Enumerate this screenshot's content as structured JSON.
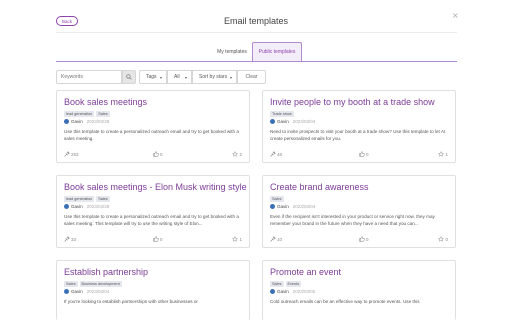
{
  "header": {
    "back_label": "Back",
    "title": "Email templates",
    "close_glyph": "×"
  },
  "tabs": [
    {
      "label": "My templates",
      "active": false
    },
    {
      "label": "Public templates",
      "active": true
    }
  ],
  "filters": {
    "search_placeholder": "Keywords",
    "tags_label": "Tags",
    "all_label": "All",
    "sort_label": "Sort by stars",
    "clear_label": "Clear"
  },
  "colors": {
    "accent": "#8e44ad",
    "title_purple": "#7d3c98",
    "tag_bg": "#e4e7ee",
    "avatar": "#3b6fb6"
  },
  "cards": [
    {
      "title": "Book sales meetings",
      "tags": [
        "lead generation",
        "Sales"
      ],
      "author": "Gavin",
      "date": "2023/03/28",
      "desc": "Use this template to create a personalized outreach email and try to get booked with a sales meeting.",
      "uses": "253",
      "likes": "0",
      "stars": "2"
    },
    {
      "title": "Invite people to my booth at a trade show",
      "tags": [
        "Trade show"
      ],
      "author": "Gavin",
      "date": "2023/03/04",
      "desc": "Need to invite prospects to visit your booth at a trade show? Use this template to let AI create personalized emails for you.",
      "uses": "46",
      "likes": "0",
      "stars": "1"
    },
    {
      "title": "Book sales meetings - Elon Musk writing style",
      "tags": [
        "lead generation",
        "Sales"
      ],
      "author": "Gavin",
      "date": "2023/03/28",
      "desc": "Use this template to create a personalized outreach email and try to get booked with a sales meeting. This template will try to use the writing style of Elon...",
      "uses": "33",
      "likes": "0",
      "stars": "1"
    },
    {
      "title": "Create brand awareness",
      "tags": [
        "Sales"
      ],
      "author": "Gavin",
      "date": "2023/03/04",
      "desc": "Even if the recipient isn't interested in your product or service right now, they may remember your brand in the future when they have a need that you can...",
      "uses": "10",
      "likes": "0",
      "stars": "0"
    },
    {
      "title": "Establish partnership",
      "tags": [
        "Sales",
        "Business development"
      ],
      "author": "Gavin",
      "date": "2023/03/04",
      "desc": "If you're looking to establish partnerships with other businesses or"
    },
    {
      "title": "Promote an event",
      "tags": [
        "Sales",
        "Events"
      ],
      "author": "Gavin",
      "date": "2023/03/05",
      "desc": "Cold outreach emails can be an effective way to promote events. Use this"
    }
  ]
}
